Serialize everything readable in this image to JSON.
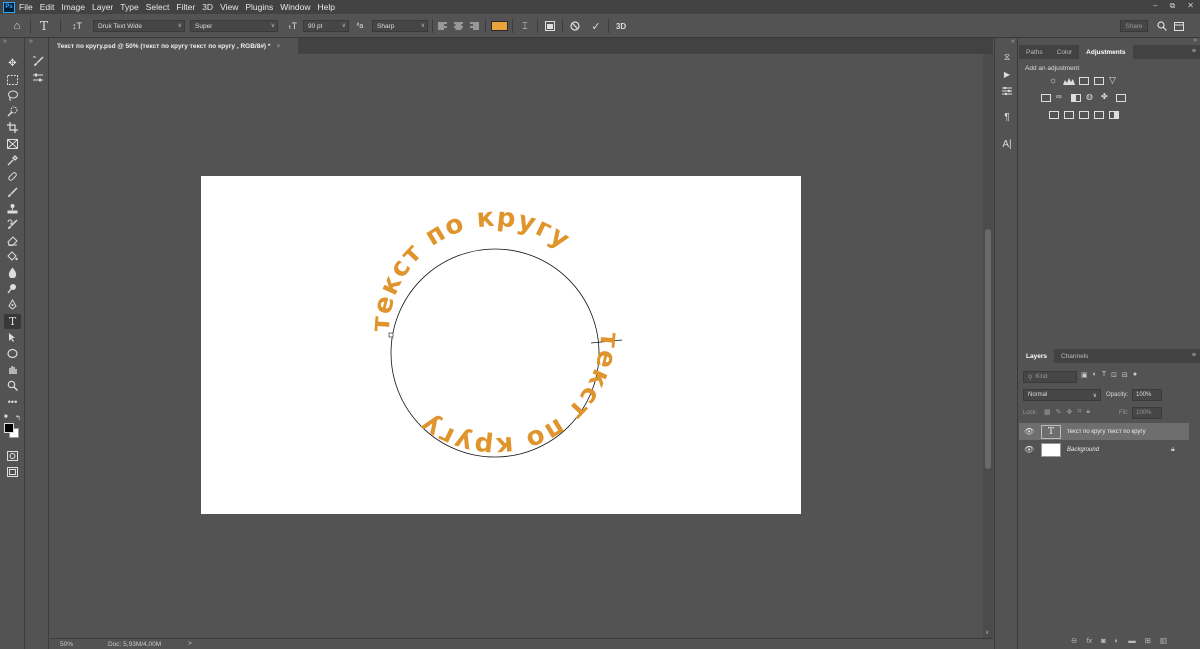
{
  "app": {
    "logo": "Ps"
  },
  "menu": [
    "File",
    "Edit",
    "Image",
    "Layer",
    "Type",
    "Select",
    "Filter",
    "3D",
    "View",
    "Plugins",
    "Window",
    "Help"
  ],
  "window_controls": [
    "–",
    "⧉",
    "✕"
  ],
  "options_bar": {
    "font_family": "Druk Text Wide",
    "font_style": "Super",
    "font_size": "90 pt",
    "aa_label": "ªa",
    "antialias": "Sharp",
    "text_color": "#e8a43a",
    "three_d": "3D",
    "share": "Share"
  },
  "document_tab": {
    "title": "Текст по кругу.psd @ 50% (текст по кругу  текст по кругу , RGB/8#) *",
    "close": "×"
  },
  "canvas": {
    "circle_text_top": "текст по кругу",
    "circle_text_bottom": "текст по кругу",
    "text_color": "#e0942c"
  },
  "status_bar": {
    "zoom": "50%",
    "doc_info": "Doc: 5,93M/4,00M",
    "arrow": ">"
  },
  "adjust_panel": {
    "tabs": [
      "Paths",
      "Color",
      "Adjustments"
    ],
    "active_tab": "Adjustments",
    "heading": "Add an adjustment"
  },
  "layers_panel": {
    "tabs": [
      "Layers",
      "Channels"
    ],
    "active_tab": "Layers",
    "kind_label": "Kind",
    "blend_mode": "Normal",
    "opacity_label": "Opacity:",
    "opacity_value": "100%",
    "lock_label": "Lock:",
    "fill_label": "Fill:",
    "fill_value": "100%",
    "layers": [
      {
        "name": "текст по кругу  текст по кругу",
        "type": "text",
        "selected": true
      },
      {
        "name": "Background",
        "type": "pixel",
        "selected": false,
        "locked": true
      }
    ]
  }
}
